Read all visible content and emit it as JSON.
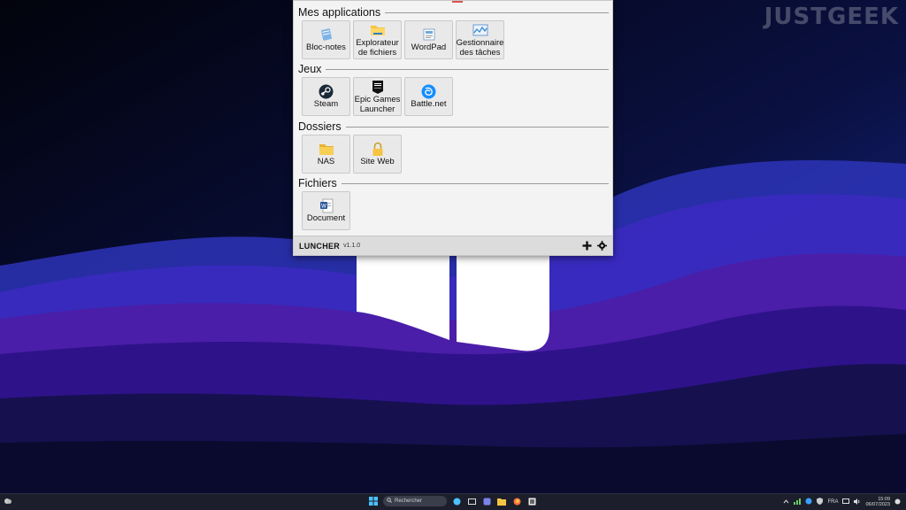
{
  "watermark": "JUSTGEEK",
  "launcher": {
    "sections": [
      {
        "title": "Mes applications",
        "items": [
          {
            "label": "Bloc-notes",
            "icon": "notepad-icon"
          },
          {
            "label": "Explorateur de fichiers",
            "icon": "folder-icon"
          },
          {
            "label": "WordPad",
            "icon": "wordpad-icon"
          },
          {
            "label": "Gestionnaire des tâches",
            "icon": "task-manager-icon"
          }
        ]
      },
      {
        "title": "Jeux",
        "items": [
          {
            "label": "Steam",
            "icon": "steam-icon"
          },
          {
            "label": "Epic Games Launcher",
            "icon": "epic-games-icon"
          },
          {
            "label": "Battle.net",
            "icon": "battlenet-icon"
          }
        ]
      },
      {
        "title": "Dossiers",
        "items": [
          {
            "label": "NAS",
            "icon": "folder-icon"
          },
          {
            "label": "Site Web",
            "icon": "lock-icon"
          }
        ]
      },
      {
        "title": "Fichiers",
        "items": [
          {
            "label": "Document",
            "icon": "word-document-icon"
          }
        ]
      }
    ],
    "footer": {
      "app_name": "LUNCHER",
      "version": "v1.1.0"
    }
  },
  "taskbar": {
    "search_placeholder": "Rechercher",
    "language": "FRA",
    "time": "15:09",
    "date": "06/07/2023"
  },
  "colors": {
    "accent_red": "#d9534f",
    "folder_yellow": "#f5c542",
    "steam_blue": "#1b2838",
    "battlenet_blue": "#148eff",
    "word_blue": "#2b579a"
  }
}
